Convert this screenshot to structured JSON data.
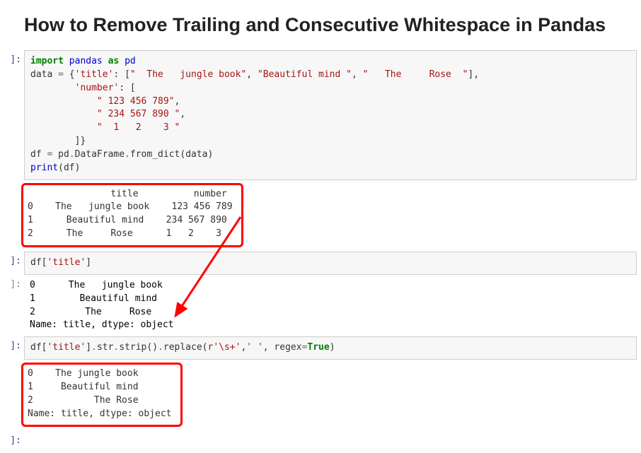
{
  "title": "How to Remove Trailing and Consecutive Whitespace in Pandas",
  "cells": {
    "c1_prompt": "]:",
    "c1_code_html": "<span class='kw'>import</span> <span class='nm'>pandas</span> <span class='kw'>as</span> <span class='nm'>pd</span>\ndata <span class='op'>=</span> {<span class='str'>'title'</span>: [<span class='str'>\"  The   jungle book\"</span>, <span class='str'>\"Beautiful mind \"</span>, <span class='str'>\"   The     Rose  \"</span>],\n        <span class='str'>'number'</span>: [\n            <span class='str'>\" 123 456 789\"</span>,\n            <span class='str'>\" 234 567 890 \"</span>,\n            <span class='str'>\"  1   2    3 \"</span>\n        ]}\ndf <span class='op'>=</span> pd<span class='op'>.</span>DataFrame<span class='op'>.</span>from_dict(data)\n<span class='fn'>print</span>(df)",
    "c1_output": "               title          number\n0    The   jungle book    123 456 789\n1      Beautiful mind    234 567 890 \n2      The     Rose      1   2    3 ",
    "c2_prompt": "]:",
    "c2_code_html": "df[<span class='str'>'title'</span>]",
    "c2_out_prompt": "]:",
    "c2_output": "0      The   jungle book\n1        Beautiful mind \n2         The     Rose  \nName: title, dtype: object",
    "c3_prompt": "]:",
    "c3_code_html": "df[<span class='str'>'title'</span>]<span class='op'>.</span>str<span class='op'>.</span>strip()<span class='op'>.</span>replace(<span class='str'>r'\\s+'</span>,<span class='str'>' '</span>, regex<span class='op'>=</span><span class='bool'>True</span>)",
    "c3_output": "0    The jungle book\n1     Beautiful mind\n2           The Rose\nName: title, dtype: object",
    "c4_prompt": "]:"
  }
}
